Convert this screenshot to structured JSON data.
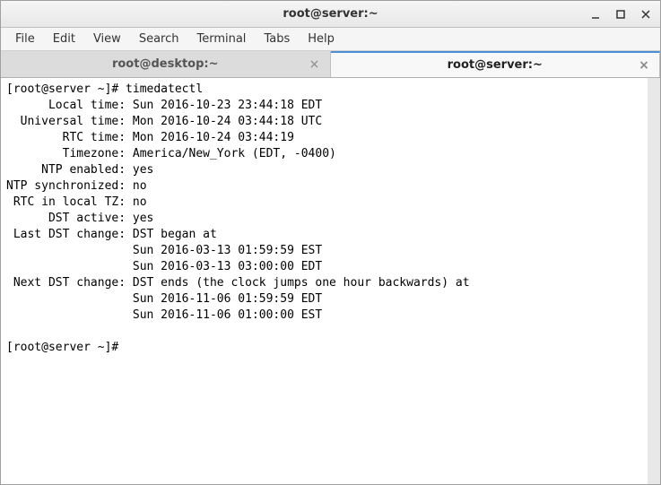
{
  "window": {
    "title": "root@server:~"
  },
  "menu": {
    "file": "File",
    "edit": "Edit",
    "view": "View",
    "search": "Search",
    "terminal": "Terminal",
    "tabs": "Tabs",
    "help": "Help"
  },
  "tabs": [
    {
      "label": "root@desktop:~",
      "active": false
    },
    {
      "label": "root@server:~",
      "active": true
    }
  ],
  "terminal": {
    "lines": [
      "[root@server ~]# timedatectl",
      "      Local time: Sun 2016-10-23 23:44:18 EDT",
      "  Universal time: Mon 2016-10-24 03:44:18 UTC",
      "        RTC time: Mon 2016-10-24 03:44:19",
      "        Timezone: America/New_York (EDT, -0400)",
      "     NTP enabled: yes",
      "NTP synchronized: no",
      " RTC in local TZ: no",
      "      DST active: yes",
      " Last DST change: DST began at",
      "                  Sun 2016-03-13 01:59:59 EST",
      "                  Sun 2016-03-13 03:00:00 EDT",
      " Next DST change: DST ends (the clock jumps one hour backwards) at",
      "                  Sun 2016-11-06 01:59:59 EDT",
      "                  Sun 2016-11-06 01:00:00 EST",
      "",
      "[root@server ~]# "
    ]
  }
}
